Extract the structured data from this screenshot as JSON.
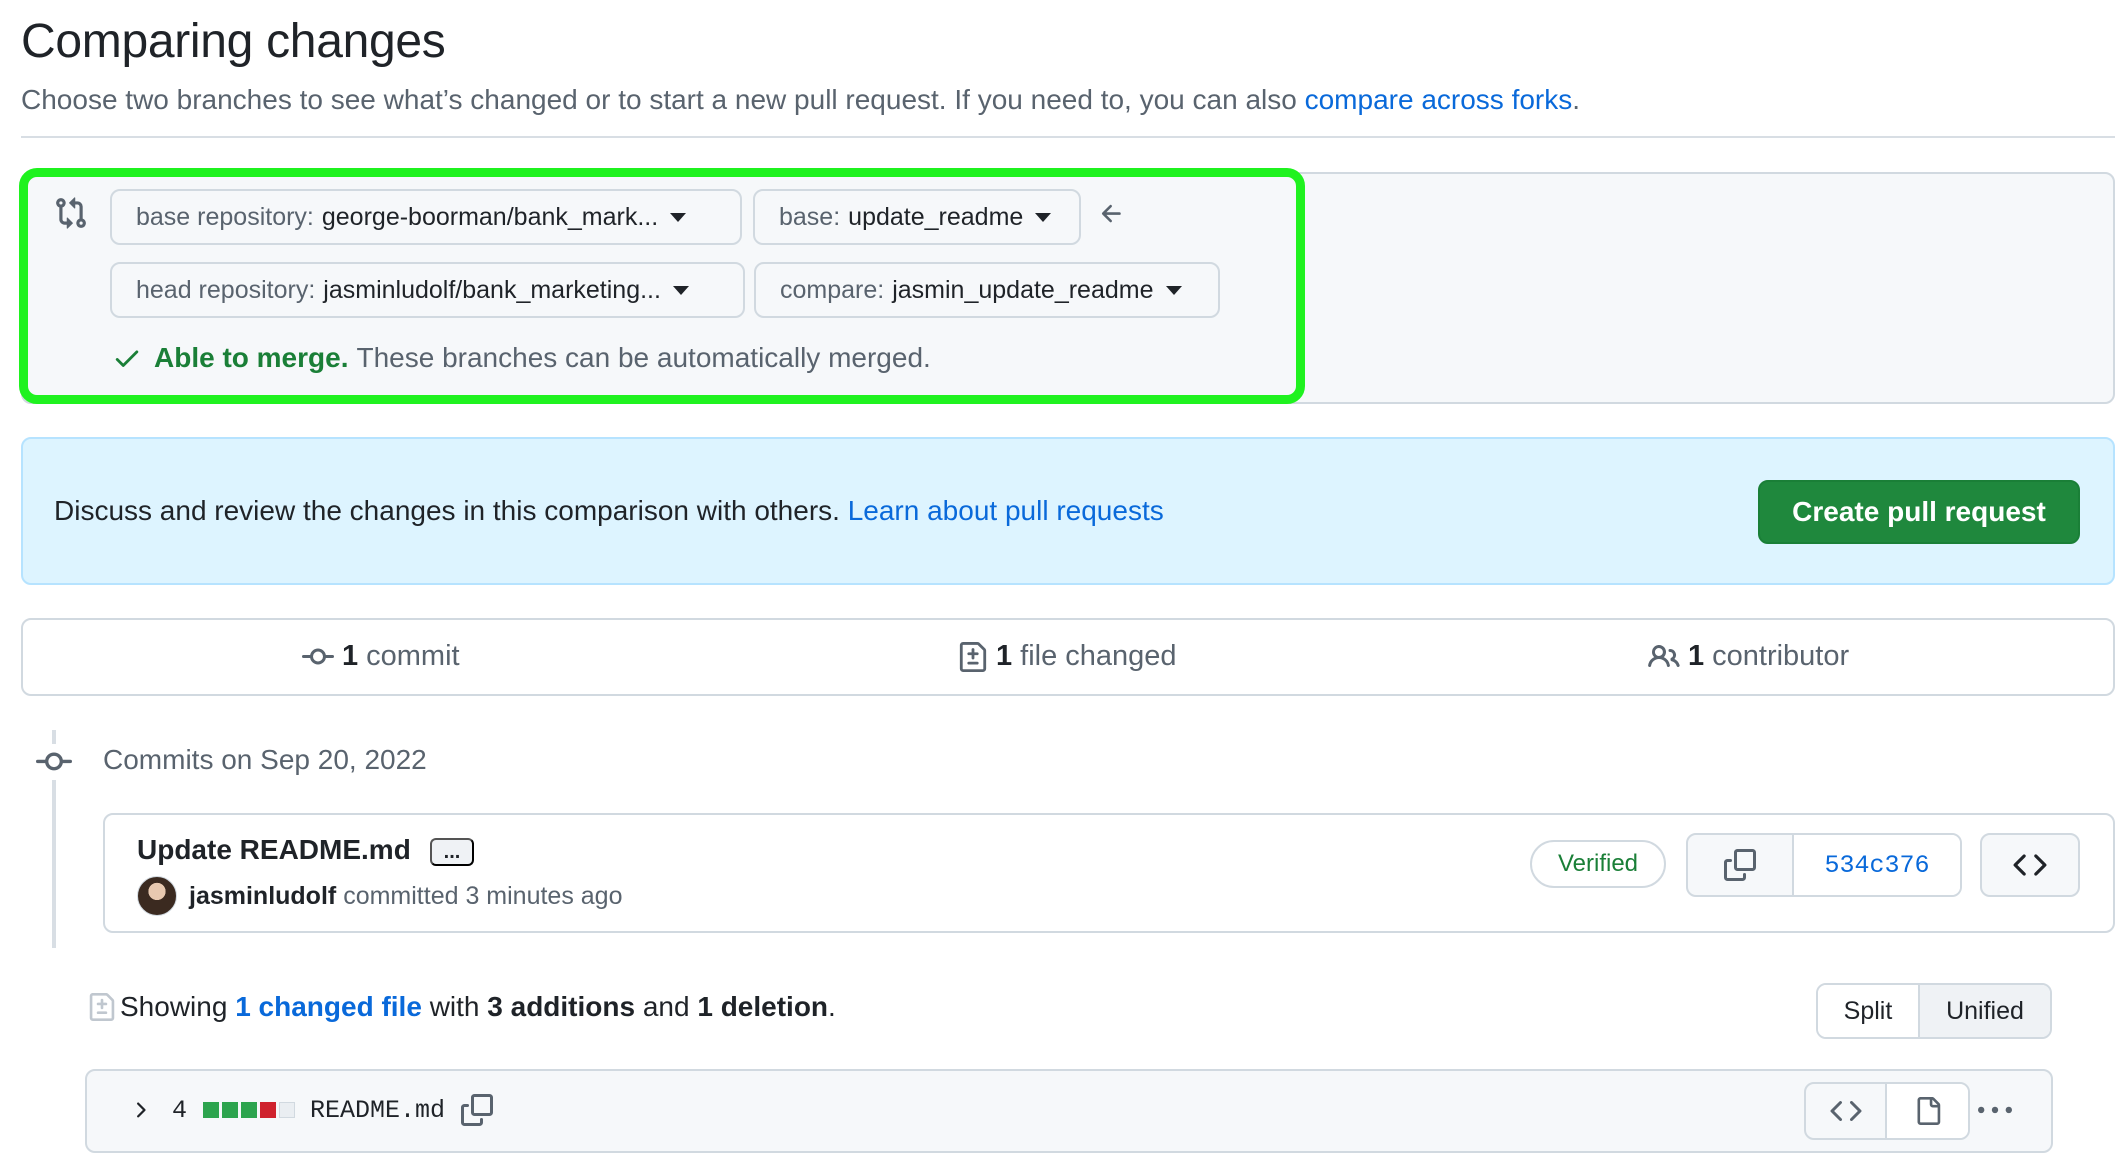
{
  "header": {
    "title": "Comparing changes",
    "description": "Choose two branches to see what’s changed or to start a new pull request. If you need to, you can also",
    "forks_link": "compare across forks",
    "period": "."
  },
  "compare": {
    "base_repo_label": "base repository:",
    "base_repo_value": "george-boorman/bank_mark...",
    "base_label": "base:",
    "base_value": "update_readme",
    "head_repo_label": "head repository:",
    "head_repo_value": "jasminludolf/bank_marketing...",
    "compare_label": "compare:",
    "compare_value": "jasmin_update_readme",
    "merge_status": "Able to merge.",
    "merge_message": "These branches can be automatically merged."
  },
  "blankslate": {
    "text": "Discuss and review the changes in this comparison with others.",
    "link": "Learn about pull requests",
    "button": "Create pull request"
  },
  "stats": {
    "commits_count": "1",
    "commits_label": "commit",
    "files_count": "1",
    "files_label": "file changed",
    "contributors_count": "1",
    "contributors_label": "contributor"
  },
  "commits": {
    "group_heading": "Commits on Sep 20, 2022",
    "items": [
      {
        "title": "Update README.md",
        "more": "...",
        "author": "jasminludolf",
        "action": "committed 3 minutes ago",
        "badge": "Verified",
        "sha": "534c376"
      }
    ]
  },
  "diff_summary": {
    "showing": "Showing",
    "changed_files": "1 changed file",
    "with": "with",
    "additions": "3 additions",
    "and": "and",
    "deletions": "1 deletion",
    "end": ".",
    "split_label": "Split",
    "unified_label": "Unified"
  },
  "file": {
    "changes": "4",
    "name": "README.md",
    "diffstat": [
      "added",
      "added",
      "added",
      "deleted",
      "neutral"
    ]
  },
  "colors": {
    "highlight": "#1ff21f",
    "primary_button": "#1f883d",
    "link": "#0969da",
    "success": "#1a7f37",
    "addition": "#2da44e",
    "deletion": "#cf222e"
  }
}
